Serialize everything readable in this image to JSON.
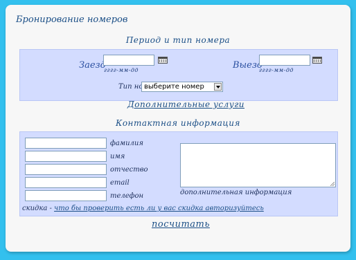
{
  "title": "Бронирование номеров",
  "period": {
    "heading": "Период и тип номера",
    "checkin_label": "Заезд",
    "checkin_hint": "гггг-мм-дд",
    "checkout_label": "Выезд",
    "checkout_hint": "гггг-мм-дд",
    "room_type_label": "Тип номера",
    "room_type_value": "выберите номер"
  },
  "extra_services_link": "Дополнительные услуги",
  "contact": {
    "heading": "Контактная информация",
    "fields": {
      "lastname": "фамилия",
      "firstname": "имя",
      "patronymic": "отчество",
      "email": "email",
      "phone": "телефон"
    },
    "additional_info_label": "дополнительная информация",
    "discount_prefix": "скидка -",
    "discount_link": "что бы проверить есть ли у вас скидка авторизуйтесь"
  },
  "calculate_link": "посчитать"
}
